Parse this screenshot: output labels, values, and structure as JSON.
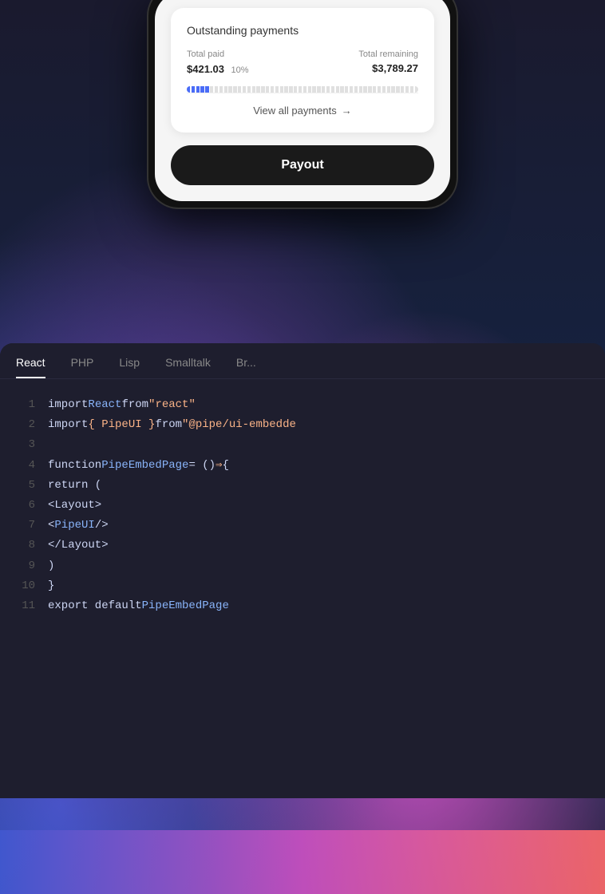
{
  "background": {
    "colors": {
      "main": "#1a1a2e",
      "gradient1": "#6b3fa0",
      "gradient2": "#c850c0",
      "gradient3": "#4158d0"
    }
  },
  "phone": {
    "card": {
      "title": "Outstanding payments",
      "total_paid_label": "Total paid",
      "total_remaining_label": "Total remaining",
      "total_paid_value": "$421.03",
      "percentage": "10%",
      "total_remaining_value": "$3,789.27",
      "progress_percent": 10,
      "view_all_label": "View all payments",
      "arrow": "→"
    },
    "payout_button_label": "Payout"
  },
  "code_editor": {
    "tabs": [
      {
        "label": "React",
        "active": true
      },
      {
        "label": "PHP",
        "active": false
      },
      {
        "label": "Lisp",
        "active": false
      },
      {
        "label": "Smalltalk",
        "active": false
      },
      {
        "label": "Br...",
        "active": false
      }
    ],
    "lines": [
      {
        "number": "1",
        "tokens": [
          {
            "type": "white",
            "text": "import "
          },
          {
            "type": "blue",
            "text": "React"
          },
          {
            "type": "white",
            "text": " from "
          },
          {
            "type": "orange",
            "text": "\"react\""
          }
        ]
      },
      {
        "number": "2",
        "tokens": [
          {
            "type": "white",
            "text": "import "
          },
          {
            "type": "orange",
            "text": "{ PipeUI }"
          },
          {
            "type": "white",
            "text": " from "
          },
          {
            "type": "orange",
            "text": "\"@pipe/ui-embedde"
          }
        ]
      },
      {
        "number": "3",
        "tokens": []
      },
      {
        "number": "4",
        "tokens": [
          {
            "type": "white",
            "text": "function "
          },
          {
            "type": "blue",
            "text": "PipeEmbedPage"
          },
          {
            "type": "white",
            "text": " = () "
          },
          {
            "type": "orange",
            "text": "⇒"
          },
          {
            "type": "white",
            "text": " {"
          }
        ]
      },
      {
        "number": "5",
        "tokens": [
          {
            "type": "white",
            "text": "    return ("
          }
        ]
      },
      {
        "number": "6",
        "tokens": [
          {
            "type": "white",
            "text": "        <Layout>"
          }
        ]
      },
      {
        "number": "7",
        "tokens": [
          {
            "type": "white",
            "text": "            <"
          },
          {
            "type": "blue",
            "text": "PipeUI"
          },
          {
            "type": "white",
            "text": " />"
          }
        ]
      },
      {
        "number": "8",
        "tokens": [
          {
            "type": "white",
            "text": "        </Layout>"
          }
        ]
      },
      {
        "number": "9",
        "tokens": [
          {
            "type": "white",
            "text": "    )"
          }
        ]
      },
      {
        "number": "10",
        "tokens": [
          {
            "type": "white",
            "text": "}"
          }
        ]
      },
      {
        "number": "11",
        "tokens": [
          {
            "type": "white",
            "text": "export default "
          },
          {
            "type": "blue",
            "text": "PipeEmbedPage"
          }
        ]
      }
    ]
  }
}
